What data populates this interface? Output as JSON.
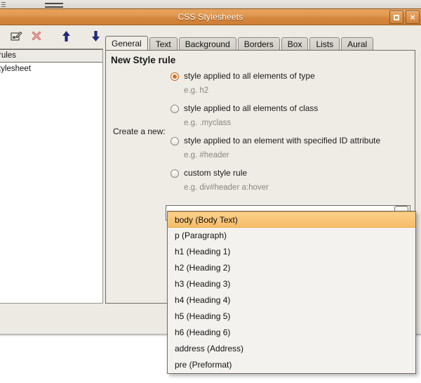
{
  "window": {
    "title": "CSS Stylesheets",
    "buttons": [
      {
        "name": "maximize-button",
        "icon": "square-icon",
        "label": ""
      },
      {
        "name": "close-button",
        "icon": "close-icon",
        "label": "×"
      }
    ]
  },
  "toolbar": {
    "items": [
      {
        "name": "edit-icon",
        "title": "Edit"
      },
      {
        "name": "delete-icon",
        "title": "Delete"
      },
      {
        "name": "move-up-icon",
        "title": "Move Up"
      },
      {
        "name": "move-down-icon",
        "title": "Move Down"
      }
    ]
  },
  "sidebar": {
    "items": [
      {
        "label": "rules",
        "selected": true
      },
      {
        "label": "tylesheet",
        "selected": false
      }
    ]
  },
  "tabs": [
    {
      "label": "General",
      "active": true
    },
    {
      "label": "Text",
      "active": false
    },
    {
      "label": "Background",
      "active": false
    },
    {
      "label": "Borders",
      "active": false
    },
    {
      "label": "Box",
      "active": false
    },
    {
      "label": "Lists",
      "active": false
    },
    {
      "label": "Aural",
      "active": false
    }
  ],
  "panel": {
    "title": "New Style rule",
    "create_label": "Create a new:",
    "options": [
      {
        "label": "style applied to all elements of type",
        "hint": "e.g. h2",
        "selected": true
      },
      {
        "label": "style applied to all elements of class",
        "hint": "e.g. .myclass",
        "selected": false
      },
      {
        "label": "style applied to an element with specified ID attribute",
        "hint": "e.g. #header",
        "selected": false
      },
      {
        "label": "custom style rule",
        "hint": "e.g. div#header a:hover",
        "selected": false
      }
    ]
  },
  "combo": {
    "value": "",
    "placeholder": "",
    "arrow_icon": "chevron-down-icon",
    "expanded": true,
    "options": [
      {
        "label": "body (Body Text)",
        "highlighted": true
      },
      {
        "label": "p (Paragraph)",
        "highlighted": false
      },
      {
        "label": "h1 (Heading 1)",
        "highlighted": false
      },
      {
        "label": "h2 (Heading 2)",
        "highlighted": false
      },
      {
        "label": "h3 (Heading 3)",
        "highlighted": false
      },
      {
        "label": "h4 (Heading 4)",
        "highlighted": false
      },
      {
        "label": "h5 (Heading 5)",
        "highlighted": false
      },
      {
        "label": "h6 (Heading 6)",
        "highlighted": false
      },
      {
        "label": "address (Address)",
        "highlighted": false
      },
      {
        "label": "pre (Preformat)",
        "highlighted": false
      }
    ]
  },
  "colors": {
    "titlebar_start": "#e8a35e",
    "titlebar_end": "#cf7f35",
    "panel_bg": "#efece6",
    "highlight": "#f5bd6a",
    "radio_accent": "#d2701d",
    "arrow_blue": "#1f2a7a",
    "delete_red": "#d9736e"
  }
}
